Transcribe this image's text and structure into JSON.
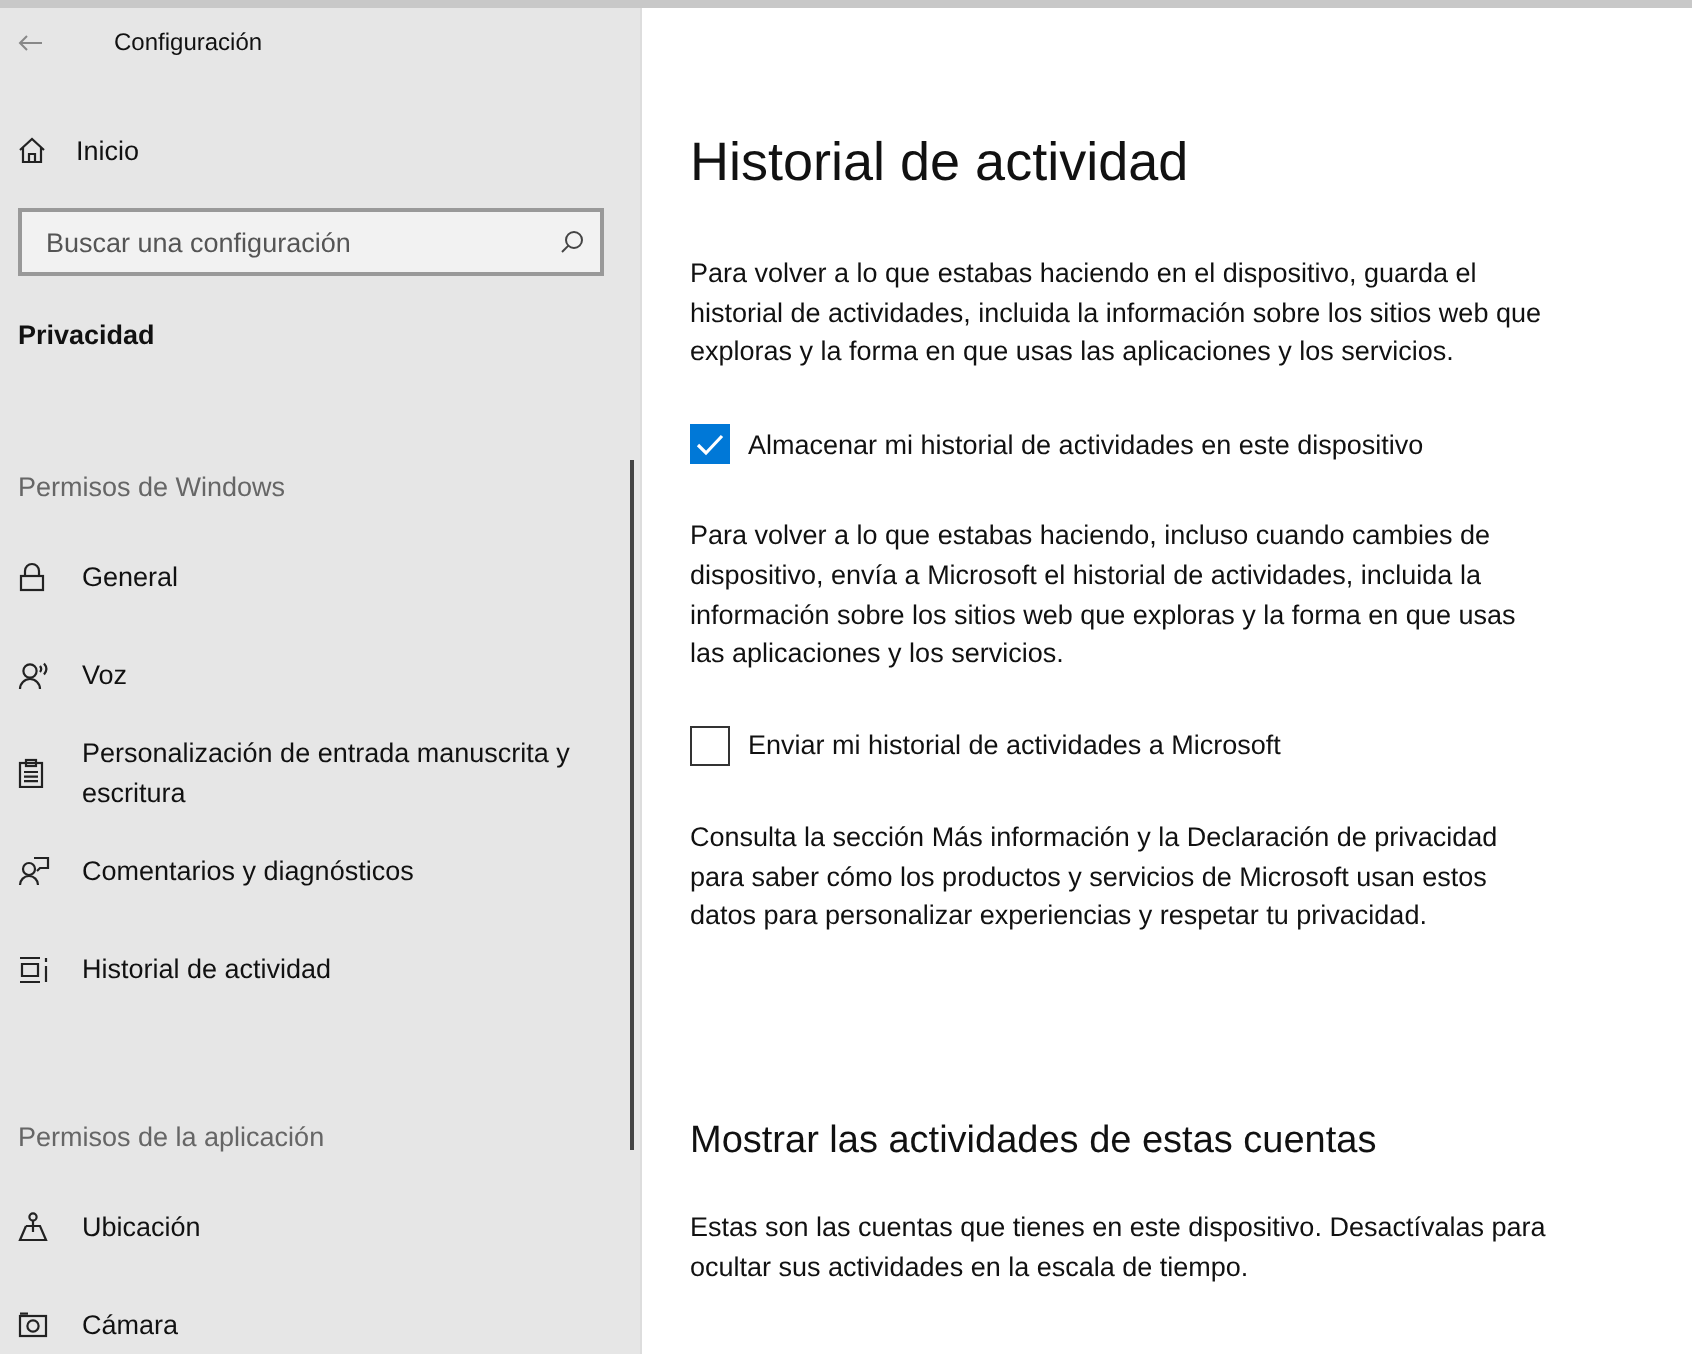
{
  "window": {
    "title": "Configuración"
  },
  "sidebar": {
    "home": "Inicio",
    "search": {
      "placeholder": "Buscar una configuración"
    },
    "section": "Privacidad",
    "groups": [
      {
        "header": "Permisos de Windows",
        "items": [
          {
            "label": "General",
            "kind": "lock"
          },
          {
            "label": "Voz",
            "kind": "voice"
          },
          {
            "label": "Personalización de entrada manuscrita y escritura",
            "kind": "clipboard"
          },
          {
            "label": "Comentarios y diagnósticos",
            "kind": "feedback"
          },
          {
            "label": "Historial de actividad",
            "kind": "timeline"
          }
        ]
      },
      {
        "header": "Permisos de la aplicación",
        "items": [
          {
            "label": "Ubicación",
            "kind": "location"
          },
          {
            "label": "Cámara",
            "kind": "camera"
          }
        ]
      }
    ]
  },
  "content": {
    "title": "Historial de actividad",
    "blocks": [
      {
        "kind": "text",
        "text": "Para volver a lo que estabas haciendo en el dispositivo, guarda el historial de actividades, incluida la información sobre los sitios web que exploras y la forma en que usas las aplicaciones y los servicios."
      },
      {
        "kind": "checkbox",
        "label": "Almacenar mi historial de actividades en este dispositivo",
        "checked": true
      },
      {
        "kind": "text",
        "text": "Para volver a lo que estabas haciendo, incluso cuando cambies de dispositivo, envía a Microsoft el historial de actividades, incluida la información sobre los sitios web que exploras y la forma en que usas las aplicaciones y los servicios."
      },
      {
        "kind": "checkbox",
        "label": "Enviar mi historial de actividades a Microsoft",
        "checked": false
      },
      {
        "kind": "text",
        "text": "Consulta la sección Más información y la Declaración de privacidad para saber cómo los productos y servicios de Microsoft usan estos datos para personalizar experiencias y respetar tu privacidad."
      },
      {
        "kind": "heading",
        "text": "Mostrar las actividades de estas cuentas"
      },
      {
        "kind": "text",
        "text": "Estas son las cuentas que tienes en este dispositivo. Desactívalas para ocultar sus actividades en la escala de tiempo."
      }
    ]
  }
}
